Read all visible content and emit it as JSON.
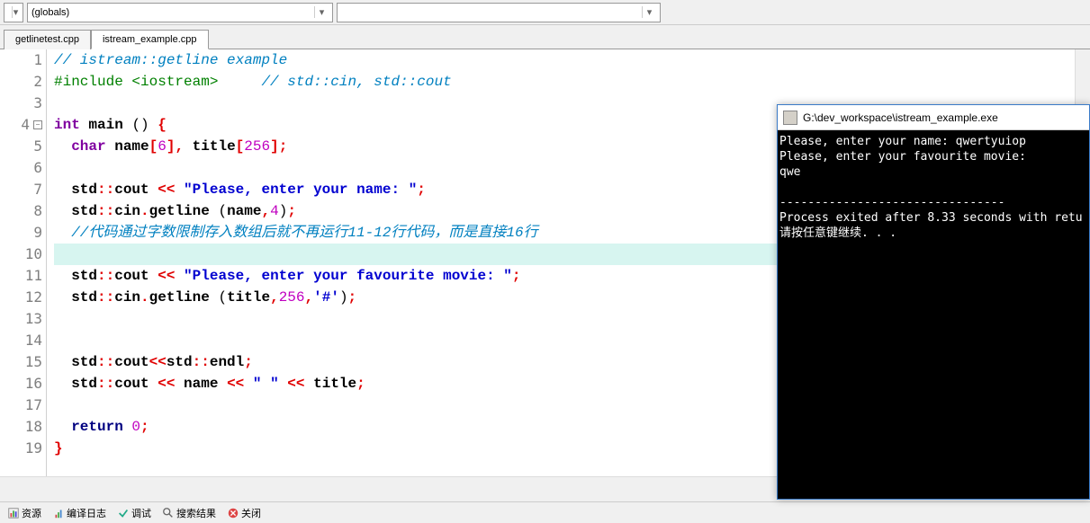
{
  "toolbar": {
    "scope_dropdown": "(globals)",
    "second_dropdown": ""
  },
  "tabs": [
    {
      "label": "getlinetest.cpp",
      "active": false
    },
    {
      "label": "istream_example.cpp",
      "active": true
    }
  ],
  "code": {
    "lines": [
      {
        "n": 1,
        "tokens": [
          [
            "c-comment",
            "// istream::getline example"
          ]
        ]
      },
      {
        "n": 2,
        "tokens": [
          [
            "c-preproc",
            "#include <iostream>"
          ],
          [
            "",
            "     "
          ],
          [
            "c-comment",
            "// std::cin, std::cout"
          ]
        ]
      },
      {
        "n": 3,
        "tokens": []
      },
      {
        "n": 4,
        "fold": true,
        "tokens": [
          [
            "c-type",
            "int"
          ],
          [
            "",
            " "
          ],
          [
            "c-black",
            "main"
          ],
          [
            "",
            " "
          ],
          [
            "c-paren",
            "()"
          ],
          [
            "",
            " "
          ],
          [
            "c-op",
            "{"
          ]
        ]
      },
      {
        "n": 5,
        "tokens": [
          [
            "",
            "  "
          ],
          [
            "c-type",
            "char"
          ],
          [
            "",
            " "
          ],
          [
            "c-black",
            "name"
          ],
          [
            "c-op",
            "["
          ],
          [
            "c-number",
            "6"
          ],
          [
            "c-op",
            "],"
          ],
          [
            "",
            " "
          ],
          [
            "c-black",
            "title"
          ],
          [
            "c-op",
            "["
          ],
          [
            "c-number",
            "256"
          ],
          [
            "c-op",
            "];"
          ]
        ]
      },
      {
        "n": 6,
        "tokens": []
      },
      {
        "n": 7,
        "tokens": [
          [
            "",
            "  "
          ],
          [
            "c-black",
            "std"
          ],
          [
            "c-op",
            "::"
          ],
          [
            "c-black",
            "cout"
          ],
          [
            "",
            " "
          ],
          [
            "c-op",
            "<<"
          ],
          [
            "",
            " "
          ],
          [
            "c-string",
            "\"Please, enter your name: \""
          ],
          [
            "c-op",
            ";"
          ]
        ]
      },
      {
        "n": 8,
        "tokens": [
          [
            "",
            "  "
          ],
          [
            "c-black",
            "std"
          ],
          [
            "c-op",
            "::"
          ],
          [
            "c-black",
            "cin"
          ],
          [
            "c-op",
            "."
          ],
          [
            "c-black",
            "getline"
          ],
          [
            "",
            " "
          ],
          [
            "c-paren",
            "("
          ],
          [
            "c-black",
            "name"
          ],
          [
            "c-op",
            ","
          ],
          [
            "c-number",
            "4"
          ],
          [
            "c-paren",
            ")"
          ],
          [
            "c-op",
            ";"
          ]
        ]
      },
      {
        "n": 9,
        "tokens": [
          [
            "",
            "  "
          ],
          [
            "c-comment",
            "//代码通过字数限制存入数组后就不再运行11-12行代码，而是直接16行"
          ]
        ]
      },
      {
        "n": 10,
        "highlight": true,
        "tokens": [
          [
            "",
            "  "
          ]
        ]
      },
      {
        "n": 11,
        "tokens": [
          [
            "",
            "  "
          ],
          [
            "c-black",
            "std"
          ],
          [
            "c-op",
            "::"
          ],
          [
            "c-black",
            "cout"
          ],
          [
            "",
            " "
          ],
          [
            "c-op",
            "<<"
          ],
          [
            "",
            " "
          ],
          [
            "c-string",
            "\"Please, enter your favourite movie: \""
          ],
          [
            "c-op",
            ";"
          ]
        ]
      },
      {
        "n": 12,
        "tokens": [
          [
            "",
            "  "
          ],
          [
            "c-black",
            "std"
          ],
          [
            "c-op",
            "::"
          ],
          [
            "c-black",
            "cin"
          ],
          [
            "c-op",
            "."
          ],
          [
            "c-black",
            "getline"
          ],
          [
            "",
            " "
          ],
          [
            "c-paren",
            "("
          ],
          [
            "c-black",
            "title"
          ],
          [
            "c-op",
            ","
          ],
          [
            "c-number",
            "256"
          ],
          [
            "c-op",
            ","
          ],
          [
            "c-string",
            "'#'"
          ],
          [
            "c-paren",
            ")"
          ],
          [
            "c-op",
            ";"
          ]
        ]
      },
      {
        "n": 13,
        "tokens": []
      },
      {
        "n": 14,
        "tokens": []
      },
      {
        "n": 15,
        "tokens": [
          [
            "",
            "  "
          ],
          [
            "c-black",
            "std"
          ],
          [
            "c-op",
            "::"
          ],
          [
            "c-black",
            "cout"
          ],
          [
            "c-op",
            "<<"
          ],
          [
            "c-black",
            "std"
          ],
          [
            "c-op",
            "::"
          ],
          [
            "c-black",
            "endl"
          ],
          [
            "c-op",
            ";"
          ]
        ]
      },
      {
        "n": 16,
        "tokens": [
          [
            "",
            "  "
          ],
          [
            "c-black",
            "std"
          ],
          [
            "c-op",
            "::"
          ],
          [
            "c-black",
            "cout"
          ],
          [
            "",
            " "
          ],
          [
            "c-op",
            "<<"
          ],
          [
            "",
            " "
          ],
          [
            "c-black",
            "name"
          ],
          [
            "",
            " "
          ],
          [
            "c-op",
            "<<"
          ],
          [
            "",
            " "
          ],
          [
            "c-string",
            "\" \""
          ],
          [
            "",
            " "
          ],
          [
            "c-op",
            "<<"
          ],
          [
            "",
            " "
          ],
          [
            "c-black",
            "title"
          ],
          [
            "c-op",
            ";"
          ]
        ]
      },
      {
        "n": 17,
        "tokens": []
      },
      {
        "n": 18,
        "tokens": [
          [
            "",
            "  "
          ],
          [
            "c-keyword",
            "return"
          ],
          [
            "",
            " "
          ],
          [
            "c-number",
            "0"
          ],
          [
            "c-op",
            ";"
          ]
        ]
      },
      {
        "n": 19,
        "tokens": [
          [
            "c-op",
            "}"
          ]
        ]
      }
    ]
  },
  "console": {
    "title": "G:\\dev_workspace\\istream_example.exe",
    "lines": [
      "Please, enter your name: qwertyuiop",
      "Please, enter your favourite movie:",
      "qwe",
      "",
      "--------------------------------",
      "Process exited after 8.33 seconds with retu",
      "请按任意键继续. . ."
    ]
  },
  "bottomBar": {
    "items": [
      {
        "icon": "report-icon",
        "label": "资源"
      },
      {
        "icon": "log-icon",
        "label": "编译日志"
      },
      {
        "icon": "debug-icon",
        "label": "调试"
      },
      {
        "icon": "search-icon",
        "label": "搜索结果"
      },
      {
        "icon": "close-icon",
        "label": "关闭"
      }
    ]
  }
}
